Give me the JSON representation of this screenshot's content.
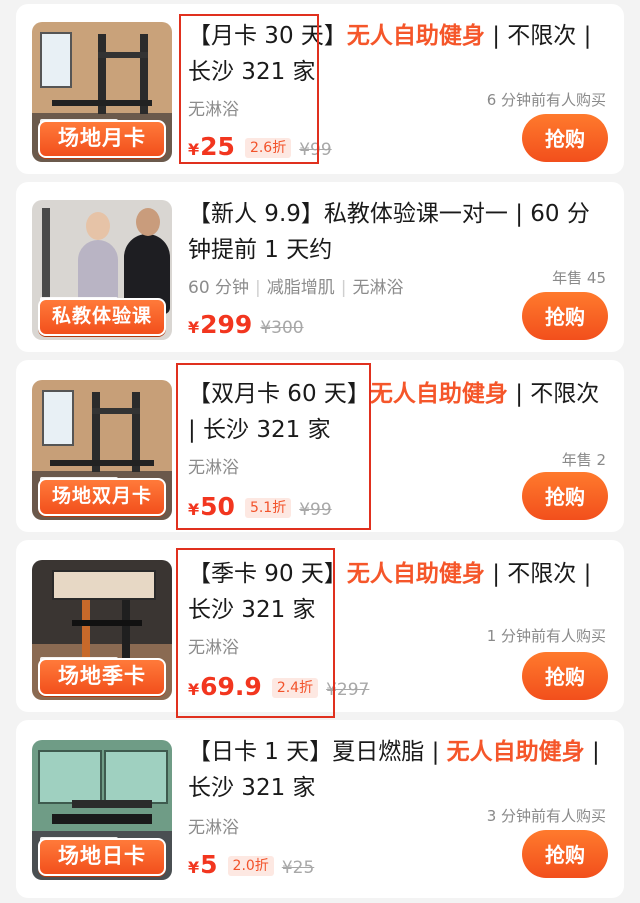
{
  "colors": {
    "accent": "#f5562a",
    "price": "#f2361f",
    "button": "#ff6a26",
    "highlight_box": "#e0301e"
  },
  "items": [
    {
      "tag": "场地月卡",
      "title_prefix": "【月卡 30 天】",
      "title_highlight": "无人自助健身",
      "title_suffix": " | 不限次 | 长沙 321 家",
      "subtitle": "无淋浴",
      "hint": "6 分钟前有人购买",
      "currency": "¥",
      "price": "25",
      "discount": "2.6折",
      "original_price": "¥99",
      "buy_label": "抢购"
    },
    {
      "tag": "私教体验课",
      "title_prefix": "【新人 9.9】私教体验课一对一 | 60 分钟提前 1 天约",
      "title_highlight": "",
      "title_suffix": "",
      "subtitle_parts": [
        "60 分钟",
        "减脂增肌",
        "无淋浴"
      ],
      "hint": "年售 45",
      "currency": "¥",
      "price": "299",
      "discount": "",
      "original_price": "¥300",
      "buy_label": "抢购"
    },
    {
      "tag": "场地双月卡",
      "title_prefix": "【双月卡 60 天】",
      "title_highlight": "无人自助健身",
      "title_suffix": " | 不限次 | 长沙 321 家",
      "subtitle": "无淋浴",
      "hint": "年售 2",
      "currency": "¥",
      "price": "50",
      "discount": "5.1折",
      "original_price": "¥99",
      "buy_label": "抢购"
    },
    {
      "tag": "场地季卡",
      "title_prefix": "【季卡 90 天】",
      "title_highlight": "无人自助健身",
      "title_suffix": " | 不限次 | 长沙 321 家",
      "subtitle": "无淋浴",
      "hint": "1 分钟前有人购买",
      "currency": "¥",
      "price": "69.9",
      "discount": "2.4折",
      "original_price": "¥297",
      "buy_label": "抢购"
    },
    {
      "tag": "场地日卡",
      "title_prefix": "【日卡 1 天】夏日燃脂 | ",
      "title_highlight": "无人自助健身",
      "title_suffix": " | 长沙 321 家",
      "subtitle": "无淋浴",
      "hint": "3 分钟前有人购买",
      "currency": "¥",
      "price": "5",
      "discount": "2.0折",
      "original_price": "¥25",
      "buy_label": "抢购"
    }
  ]
}
